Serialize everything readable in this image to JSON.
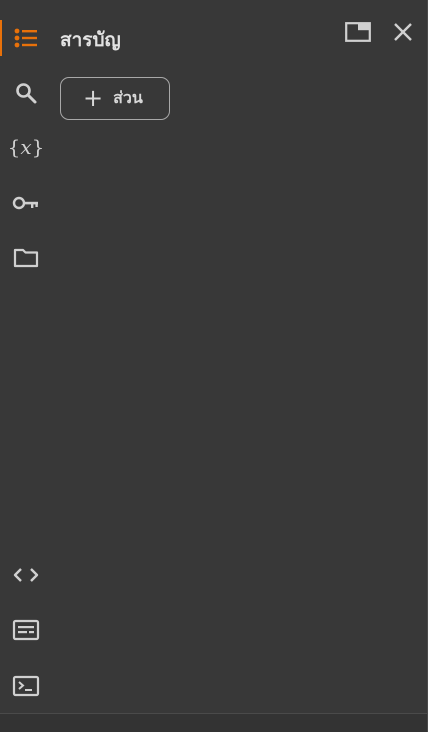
{
  "panel": {
    "title": "สารบัญ",
    "add_section_label": "ส่วน",
    "add_section_icon": "+"
  },
  "rail": {
    "items": [
      {
        "name": "table-of-contents-icon",
        "active": true
      },
      {
        "name": "search-icon",
        "active": false
      },
      {
        "name": "variables-icon",
        "active": false,
        "glyph": "{x}"
      },
      {
        "name": "key-icon",
        "active": false
      },
      {
        "name": "folder-icon",
        "active": false
      },
      {
        "name": "code-snippets-icon",
        "active": false
      },
      {
        "name": "command-palette-icon",
        "active": false
      },
      {
        "name": "terminal-icon",
        "active": false
      }
    ]
  },
  "header_actions": [
    {
      "name": "open-in-tab-icon"
    },
    {
      "name": "close-icon"
    }
  ],
  "colors": {
    "background": "#383838",
    "accent": "#e8710a",
    "icon": "#d0d0d0",
    "text": "#e3e3e3",
    "border": "#a8a8a8"
  }
}
